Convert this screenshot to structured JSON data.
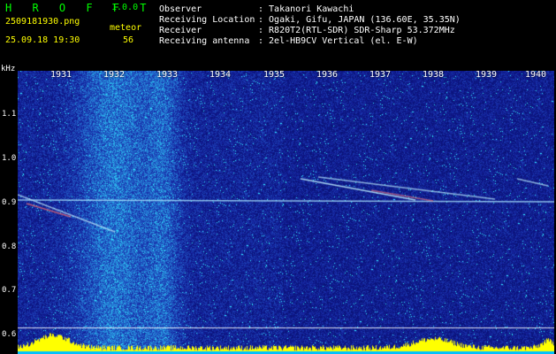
{
  "header": {
    "app_title": "H R O F F T",
    "app_version": "1.0.0",
    "filename": "2509181930.png",
    "datetime": "25.09.18 19:30",
    "meteor_label": "meteor",
    "meteor_count": "56",
    "info": [
      {
        "label": "Observer",
        "value": ": Takanori Kawachi"
      },
      {
        "label": "Receiving Location",
        "value": ": Ogaki, Gifu, JAPAN (136.60E, 35.35N)"
      },
      {
        "label": "Receiver",
        "value": ": R820T2(RTL-SDR) SDR-Sharp 53.372MHz"
      },
      {
        "label": "Receiving antenna",
        "value": ": 2el-HB9CV Vertical (el. E-W)"
      }
    ]
  },
  "axis": {
    "unit": "kHz",
    "y_ticks": [
      "1.1",
      "1.0",
      "0.9",
      "0.8",
      "0.7",
      "0.6"
    ],
    "x_ticks": [
      "1931",
      "1932",
      "1933",
      "1934",
      "1935",
      "1936",
      "1937",
      "1938",
      "1939",
      "1940"
    ]
  },
  "colors": {
    "background": "#0a1a8c",
    "noise_low": "#1a2fb8",
    "noise_high": "#28e0e8",
    "carrier": "#9fe8ff",
    "meteor_hot": "#ff6060",
    "signal_bar": "#ffff00",
    "baseline": "#00c0ff",
    "title_green": "#00ff00"
  }
}
